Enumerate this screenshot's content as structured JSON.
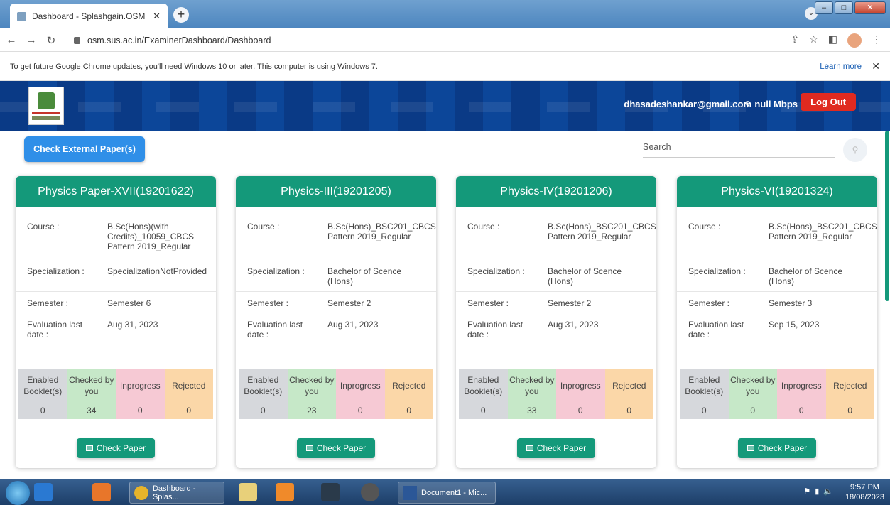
{
  "browser": {
    "tab_title": "Dashboard - Splashgain.OSM",
    "url": "osm.sus.ac.in/ExaminerDashboard/Dashboard",
    "info_message": "To get future Google Chrome updates, you'll need Windows 10 or later. This computer is using Windows 7.",
    "learn_more": "Learn more"
  },
  "header": {
    "email": "dhasadeshankar@gmail.com",
    "speed": "null Mbps",
    "logout": "Log Out"
  },
  "toolbar": {
    "check_external": "Check External Paper(s)",
    "search_placeholder": "Search"
  },
  "labels": {
    "course": "Course :",
    "specialization": "Specialization :",
    "semester": "Semester :",
    "eval_date": "Evaluation last date :",
    "enabled": "Enabled Booklet(s)",
    "checked": "Checked by you",
    "inprogress": "Inprogress",
    "rejected": "Rejected",
    "check_paper": "Check Paper"
  },
  "cards": [
    {
      "title": "Physics Paper-XVII(19201622)",
      "course": "B.Sc(Hons)(with Credits)_10059_CBCS Pattern 2019_Regular",
      "specialization": "SpecializationNotProvided",
      "semester": "Semester 6",
      "eval_date": "Aug 31, 2023",
      "enabled": "0",
      "checked": "34",
      "inprogress": "0",
      "rejected": "0"
    },
    {
      "title": "Physics-III(19201205)",
      "course": "B.Sc(Hons)_BSC201_CBCS Pattern 2019_Regular",
      "specialization": "Bachelor of Scence (Hons)",
      "semester": "Semester 2",
      "eval_date": "Aug 31, 2023",
      "enabled": "0",
      "checked": "23",
      "inprogress": "0",
      "rejected": "0"
    },
    {
      "title": "Physics-IV(19201206)",
      "course": "B.Sc(Hons)_BSC201_CBCS Pattern 2019_Regular",
      "specialization": "Bachelor of Scence (Hons)",
      "semester": "Semester 2",
      "eval_date": "Aug 31, 2023",
      "enabled": "0",
      "checked": "33",
      "inprogress": "0",
      "rejected": "0"
    },
    {
      "title": "Physics-VI(19201324)",
      "course": "B.Sc(Hons)_BSC201_CBCS Pattern 2019_Regular",
      "specialization": "Bachelor of Scence (Hons)",
      "semester": "Semester 3",
      "eval_date": "Sep 15, 2023",
      "enabled": "0",
      "checked": "0",
      "inprogress": "0",
      "rejected": "0"
    }
  ],
  "taskbar": {
    "chrome_label": "Dashboard - Splas...",
    "word_label": "Document1 - Mic...",
    "time": "9:57 PM",
    "date": "18/08/2023"
  }
}
